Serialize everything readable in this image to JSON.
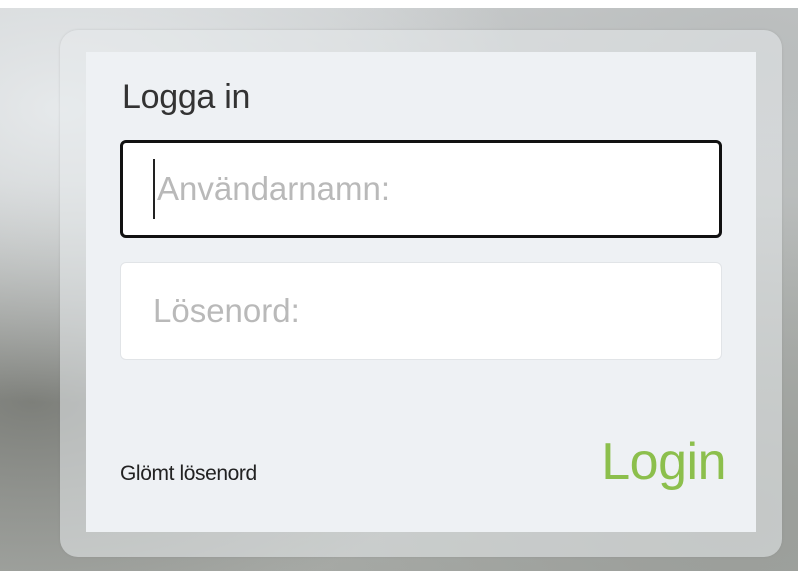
{
  "login_form": {
    "title": "Logga in",
    "username_placeholder": "Användarnamn:",
    "username_value": "",
    "password_placeholder": "Lösenord:",
    "password_value": "",
    "forgot_password_label": "Glömt lösenord",
    "login_label": "Login"
  },
  "colors": {
    "login_text": "#8cbf4c",
    "panel_background": "#eef1f4",
    "focused_border": "#111111",
    "placeholder_text": "#b9b9b9"
  }
}
